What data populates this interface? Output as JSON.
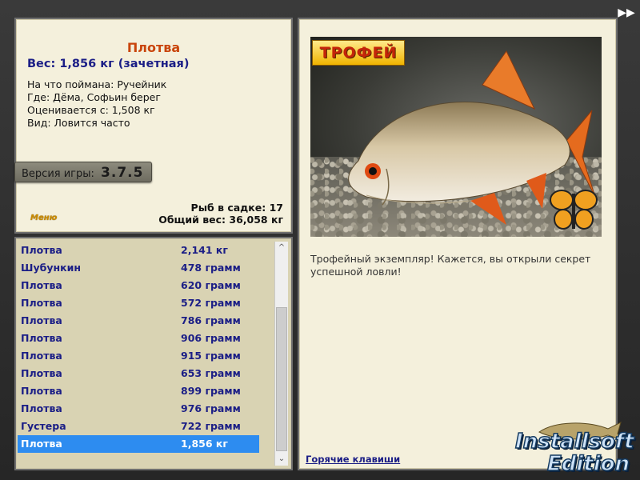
{
  "info": {
    "fish_name": "Плотва",
    "weight_line": "Вес: 1,856 кг (зачетная)",
    "caught_on": "На что поймана: Ручейник",
    "location": "Где: Дёма, Софьин берег",
    "rated_from": "Оценивается с: 1,508 кг",
    "species": "Вид: Ловится часто",
    "version_label": "Версия игры:",
    "version_value": "3.7.5",
    "menu_link": "Меню",
    "fish_in_net": "Рыб в садке: 17",
    "total_weight": "Общий вес: 36,058 кг"
  },
  "catch_list": [
    {
      "name": "Плотва",
      "weight": "2,141 кг"
    },
    {
      "name": "Шубункин",
      "weight": "478 грамм"
    },
    {
      "name": "Плотва",
      "weight": "620 грамм"
    },
    {
      "name": "Плотва",
      "weight": "572 грамм"
    },
    {
      "name": "Плотва",
      "weight": "786 грамм"
    },
    {
      "name": "Плотва",
      "weight": "906 грамм"
    },
    {
      "name": "Плотва",
      "weight": "915 грамм"
    },
    {
      "name": "Плотва",
      "weight": "653 грамм"
    },
    {
      "name": "Плотва",
      "weight": "899 грамм"
    },
    {
      "name": "Плотва",
      "weight": "976 грамм"
    },
    {
      "name": "Густера",
      "weight": "722 грамм"
    },
    {
      "name": "Плотва",
      "weight": "1,856 кг"
    }
  ],
  "detail": {
    "trophy_badge": "ТРОФЕЙ",
    "description": "Трофейный экземпляр! Кажется, вы открыли секрет успешной ловли!",
    "hotkeys_link": "Горячие клавиши"
  },
  "brand": {
    "line1": "Installsoft",
    "line2": "Edition"
  },
  "colors": {
    "title": "#c9450c",
    "link_blue": "#1b1e86",
    "selection": "#2d8cf0",
    "panel_bg": "#f4f0dc"
  }
}
